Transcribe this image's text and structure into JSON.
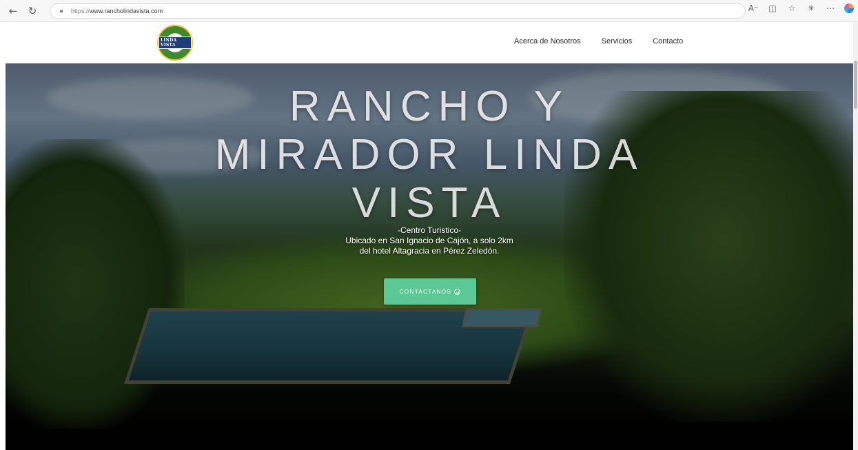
{
  "browser": {
    "url_protocol": "https://",
    "url_host": "www.rancholindavista.com",
    "back_icon": "back-arrow-icon",
    "refresh_icon": "refresh-icon",
    "tools": [
      "read-aloud-icon",
      "immersive-reader-icon",
      "favorite-star-icon",
      "favorites-list-icon",
      "more-icon",
      "copilot-icon"
    ]
  },
  "header": {
    "logo_text": "LINDA VISTA",
    "nav": [
      "Acerca de Nosotros",
      "Servicios",
      "Contacto"
    ]
  },
  "hero": {
    "title": "RANCHO Y MIRADOR LINDA VISTA",
    "subtitle_line1": "-Centro Turistico-",
    "subtitle_line2": "Ubicado en San Ignacio de Cajón, a solo 2km",
    "subtitle_line3": "del hotel Altagracia en Pérez Zeledón.",
    "cta_label": "CONTACTANOS"
  },
  "colors": {
    "cta": "#5cc896",
    "nav_text": "#2b2b2b",
    "hero_text": "#ffffff"
  }
}
